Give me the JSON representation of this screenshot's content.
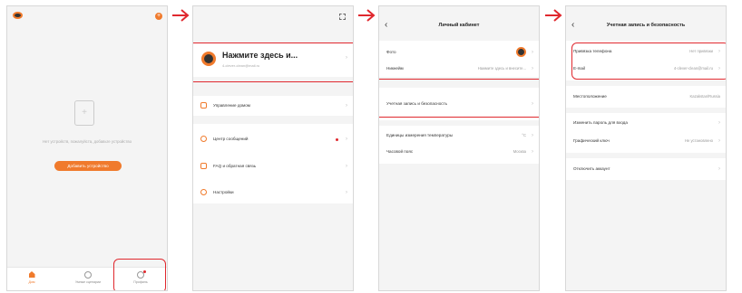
{
  "screen1": {
    "empty_text": "Нет устройств, пожалуйста, добавьте устройство",
    "add_button": "Добавить устройство",
    "nav": [
      {
        "label": "Дом"
      },
      {
        "label": "Умные сценарии"
      },
      {
        "label": "Профиль"
      }
    ]
  },
  "screen2": {
    "username": "Нажмите здесь и...",
    "email": "4-clever-clean@mail.ru",
    "menu": [
      {
        "label": "Управление домом"
      },
      {
        "label": "Центр сообщений"
      },
      {
        "label": "FAQ и обратная связь"
      },
      {
        "label": "Настройки"
      }
    ]
  },
  "screen3": {
    "title": "Личный кабинет",
    "rows": [
      {
        "label": "Фото",
        "value": ""
      },
      {
        "label": "Никнейм",
        "value": "Нажмите здесь и внесите..."
      },
      {
        "label": "Учетная запись и безопасность",
        "value": ""
      },
      {
        "label": "Единицы измерения температуры",
        "value": "°C"
      },
      {
        "label": "Часовой пояс",
        "value": "Москва"
      }
    ]
  },
  "screen4": {
    "title": "Учетная запись и безопасность",
    "rows": [
      {
        "label": "Привязка телефона",
        "value": "Нет привязки"
      },
      {
        "label": "E-mail",
        "value": "4-clever-clean@mail.ru"
      },
      {
        "label": "Местоположение",
        "value": "Kazakstan/Russia"
      },
      {
        "label": "Изменить пароль для входа",
        "value": ""
      },
      {
        "label": "Графический ключ",
        "value": "Не установлено"
      },
      {
        "label": "Отключить аккаунт",
        "value": ""
      }
    ]
  },
  "colors": {
    "accent": "#f07a2c",
    "highlight": "#e0282e"
  }
}
